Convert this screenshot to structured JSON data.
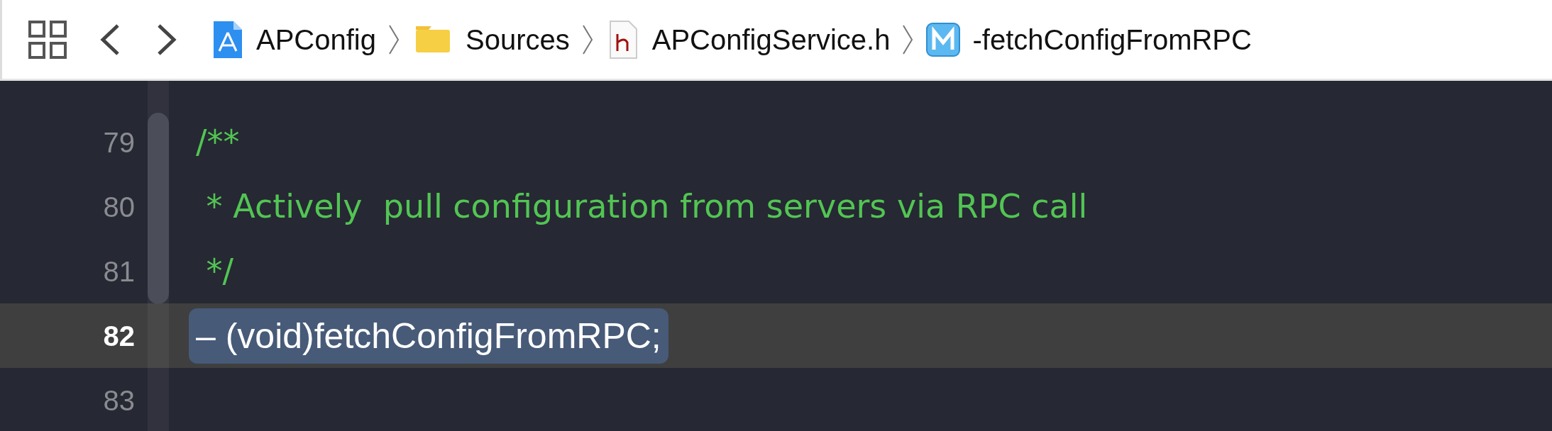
{
  "toolbar": {
    "breadcrumbs": [
      {
        "kind": "project",
        "label": "APConfig"
      },
      {
        "kind": "folder",
        "label": "Sources"
      },
      {
        "kind": "header",
        "label": "APConfigService.h"
      },
      {
        "kind": "method",
        "label": "-fetchConfigFromRPC"
      }
    ]
  },
  "editor": {
    "lines": [
      {
        "number": "79",
        "kind": "comment",
        "text": "/**",
        "current": false,
        "selected": false
      },
      {
        "number": "80",
        "kind": "comment",
        "text": " * Actively  pull configuration from servers via RPC call",
        "current": false,
        "selected": false
      },
      {
        "number": "81",
        "kind": "comment",
        "text": " */",
        "current": false,
        "selected": false
      },
      {
        "number": "82",
        "kind": "code",
        "text": "– (void)fetchConfigFromRPC;",
        "current": true,
        "selected": true
      },
      {
        "number": "83",
        "current": false
      }
    ]
  }
}
